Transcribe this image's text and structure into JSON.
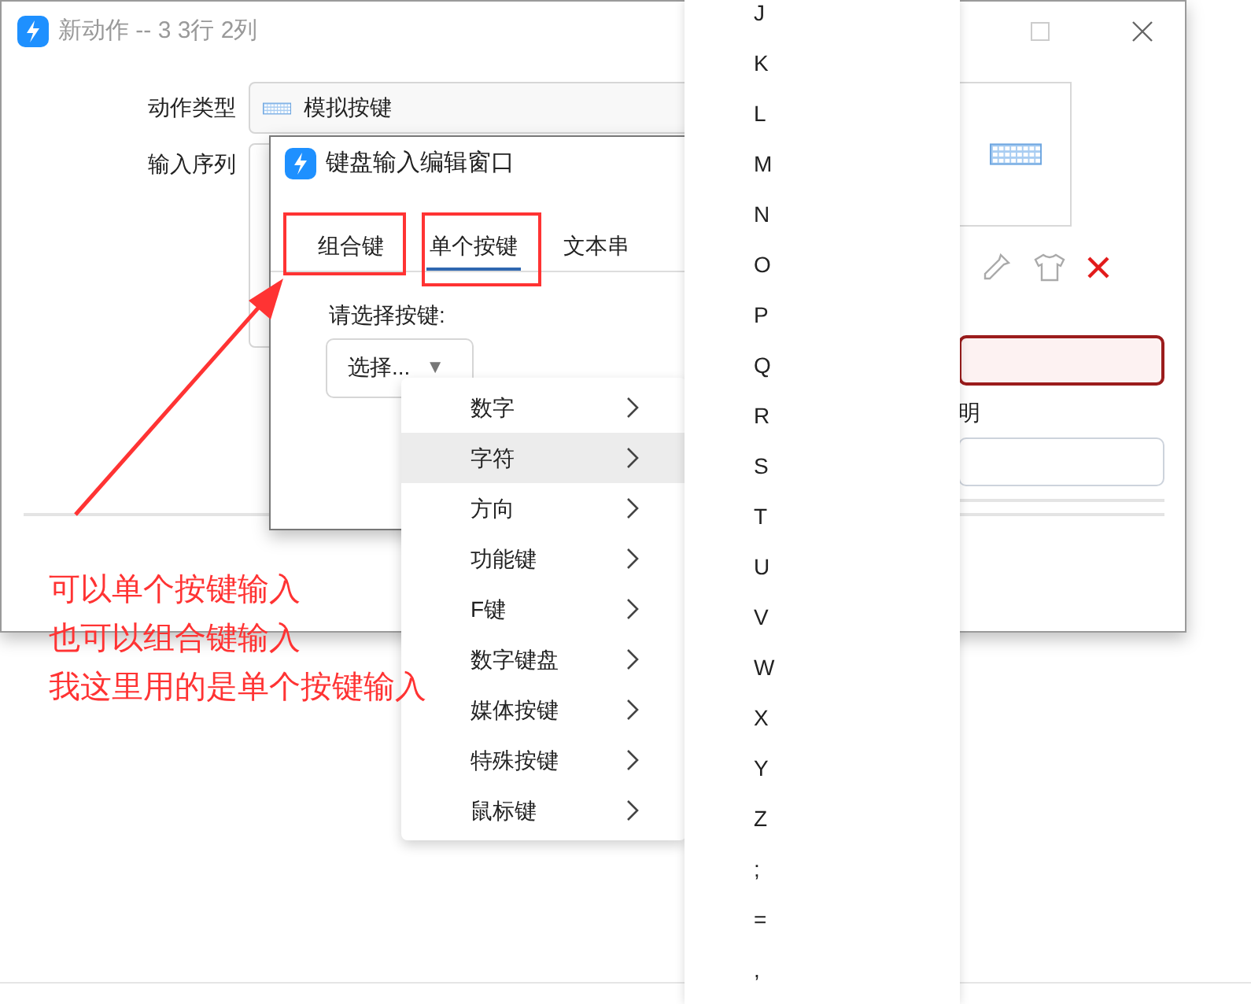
{
  "window": {
    "title": "新动作 -- 3 3行 2列"
  },
  "form": {
    "action_type_label": "动作类型",
    "action_type_value": "模拟按键",
    "input_sequence_label": "输入序列",
    "description_label_fragment": "明"
  },
  "dialog": {
    "title": "键盘输入编辑窗口",
    "tabs": [
      {
        "label": "组合键",
        "selected": false
      },
      {
        "label": "单个按键",
        "selected": true
      },
      {
        "label": "文本串",
        "selected": false
      }
    ],
    "prompt": "请选择按键:",
    "dropdown": {
      "label": "选择...",
      "caret": "▼"
    }
  },
  "submenu": [
    {
      "label": "数字",
      "selected": false
    },
    {
      "label": "字符",
      "selected": true
    },
    {
      "label": "方向",
      "selected": false
    },
    {
      "label": "功能键",
      "selected": false
    },
    {
      "label": "F键",
      "selected": false
    },
    {
      "label": "数字键盘",
      "selected": false
    },
    {
      "label": "媒体按键",
      "selected": false
    },
    {
      "label": "特殊按键",
      "selected": false
    },
    {
      "label": "鼠标键",
      "selected": false
    }
  ],
  "key_list": [
    "J",
    "K",
    "L",
    "M",
    "N",
    "O",
    "P",
    "Q",
    "R",
    "S",
    "T",
    "U",
    "V",
    "W",
    "X",
    "Y",
    "Z",
    ";",
    "=",
    ","
  ],
  "annotation": {
    "lines": [
      "可以单个按键输入",
      "也可以组合键输入",
      "我这里用的是单个按键输入"
    ]
  }
}
